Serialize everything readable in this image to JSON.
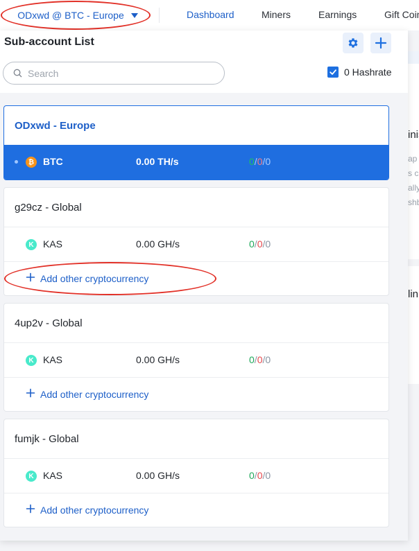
{
  "nav": {
    "account_label": "ODxwd @ BTC - Europe",
    "links": [
      "Dashboard",
      "Miners",
      "Earnings",
      "Gift Coin"
    ],
    "active_index": 0
  },
  "panel": {
    "title": "Sub-account List",
    "search_placeholder": "Search",
    "hashrate_label": "0 Hashrate",
    "hashrate_checked": true
  },
  "background_fragments": [
    "inis",
    "ap",
    "s c",
    "ally",
    "shb",
    "lin"
  ],
  "cards": [
    {
      "title": "ODxwd - Europe",
      "active": true,
      "coins": [
        {
          "name": "BTC",
          "icon": "bitcoin-icon",
          "hashrate": "0.00 TH/s",
          "online": "0",
          "offline": "0",
          "inactive": "0"
        }
      ]
    },
    {
      "title": "g29cz - Global",
      "active": false,
      "coins": [
        {
          "name": "KAS",
          "icon": "kaspa-icon",
          "hashrate": "0.00 GH/s",
          "online": "0",
          "offline": "0",
          "inactive": "0"
        }
      ],
      "add_label": "Add other cryptocurrency"
    },
    {
      "title": "4up2v - Global",
      "active": false,
      "coins": [
        {
          "name": "KAS",
          "icon": "kaspa-icon",
          "hashrate": "0.00 GH/s",
          "online": "0",
          "offline": "0",
          "inactive": "0"
        }
      ],
      "add_label": "Add other cryptocurrency"
    },
    {
      "title": "fumjk - Global",
      "active": false,
      "coins": [
        {
          "name": "KAS",
          "icon": "kaspa-icon",
          "hashrate": "0.00 GH/s",
          "online": "0",
          "offline": "0",
          "inactive": "0"
        }
      ],
      "add_label": "Add other cryptocurrency"
    }
  ],
  "count_separator": "/",
  "colors": {
    "accent": "#1d5fc8",
    "active_row": "#1f6ee0",
    "online": "#1ea85a",
    "offline": "#e5484d",
    "inactive": "#8a95a3",
    "bitcoin": "#f7931a",
    "kaspa": "#49eacb",
    "annotation": "#e23128"
  }
}
